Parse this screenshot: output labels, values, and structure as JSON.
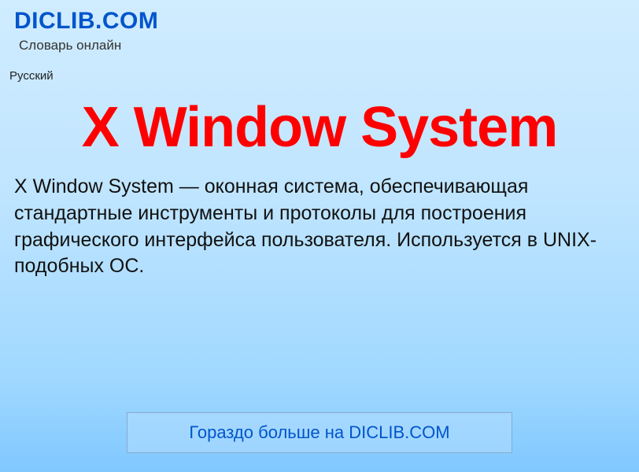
{
  "header": {
    "site_name": "DICLIB.COM",
    "tagline": "Словарь онлайн"
  },
  "language": "Русский",
  "title": "X Window System",
  "description": "X Window System — оконная система, обеспечивающая стандартные инструменты и протоколы для построения графического интерфейса пользователя. Используется в UNIX-подобных ОС.",
  "footer": {
    "link_text": "Гораздо больше на DICLIB.COM"
  }
}
